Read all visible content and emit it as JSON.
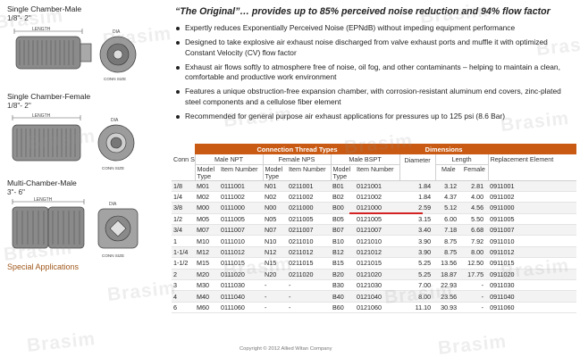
{
  "left": {
    "products": [
      {
        "title": "Single Chamber-Male",
        "size": "1/8\"- 2\"",
        "dim_length": "LENGTH",
        "dim_dia": "DIA",
        "dim_conn": "CONN SIZE"
      },
      {
        "title": "Single Chamber-Female",
        "size": "1/8\"- 2\"",
        "dim_length": "LENGTH",
        "dim_dia": "DIA",
        "dim_conn": "CONN SIZE"
      },
      {
        "title": "Multi-Chamber-Male",
        "size": "3\"- 6\"",
        "dim_length": "LENGTH",
        "dim_dia": "DIA",
        "dim_conn": "CONN SIZE"
      }
    ],
    "special_link": "Special Applications"
  },
  "headline": "“The Original”… provides up to 85% perceived noise reduction and 94% flow factor",
  "bullets": [
    "Expertly reduces Exponentially Perceived Noise (EPNdB) without impeding equipment performance",
    "Designed to take explosive air exhaust noise discharged from valve exhaust ports and muffle it with optimized Constant Velocity (CV) flow factor",
    "Exhaust air flows softly to atmosphere free of noise, oil fog, and other contaminants – helping to maintain a clean, comfortable and productive work environment",
    "Features a unique obstruction-free expansion chamber, with corrosion-resistant aluminum end covers, zinc-plated steel components and a cellulose fiber element",
    "Recommended for general purpose air exhaust applications for pressures up to 125 psi (8.6 Bar)"
  ],
  "table": {
    "band_connection": "Connection Thread Types",
    "band_dimensions": "Dimensions",
    "h_conn": "Conn Size",
    "h_male_npt": "Male NPT",
    "h_female_nps": "Female NPS",
    "h_male_bspt": "Male BSPT",
    "h_diameter": "Diameter",
    "h_length": "Length",
    "h_replacement": "Replacement Element",
    "h_model_type": "Model Type",
    "h_item_number": "Item Number",
    "h_male": "Male",
    "h_female": "Female",
    "rows": [
      [
        "1/8",
        "M01",
        "0111001",
        "N01",
        "0211001",
        "B01",
        "0121001",
        "1.84",
        "3.12",
        "2.81",
        "0911001"
      ],
      [
        "1/4",
        "M02",
        "0111002",
        "N02",
        "0211002",
        "B02",
        "0121002",
        "1.84",
        "4.37",
        "4.00",
        "0911002"
      ],
      [
        "3/8",
        "M00",
        "0111000",
        "N00",
        "0211000",
        "B00",
        "0121000",
        "2.59",
        "5.12",
        "4.56",
        "0911000"
      ],
      [
        "1/2",
        "M05",
        "0111005",
        "N05",
        "0211005",
        "B05",
        "0121005",
        "3.15",
        "6.00",
        "5.50",
        "0911005"
      ],
      [
        "3/4",
        "M07",
        "0111007",
        "N07",
        "0211007",
        "B07",
        "0121007",
        "3.40",
        "7.18",
        "6.68",
        "0911007"
      ],
      [
        "1",
        "M10",
        "0111010",
        "N10",
        "0211010",
        "B10",
        "0121010",
        "3.90",
        "8.75",
        "7.92",
        "0911010"
      ],
      [
        "1-1/4",
        "M12",
        "0111012",
        "N12",
        "0211012",
        "B12",
        "0121012",
        "3.90",
        "8.75",
        "8.00",
        "0911012"
      ],
      [
        "1-1/2",
        "M15",
        "0111015",
        "N15",
        "0211015",
        "B15",
        "0121015",
        "5.25",
        "13.56",
        "12.50",
        "0911015"
      ],
      [
        "2",
        "M20",
        "0111020",
        "N20",
        "0211020",
        "B20",
        "0121020",
        "5.25",
        "18.87",
        "17.75",
        "0911020"
      ],
      [
        "3",
        "M30",
        "0111030",
        "-",
        "-",
        "B30",
        "0121030",
        "7.00",
        "22.93",
        "-",
        "0911030"
      ],
      [
        "4",
        "M40",
        "0111040",
        "-",
        "-",
        "B40",
        "0121040",
        "8.00",
        "23.56",
        "-",
        "0911040"
      ],
      [
        "6",
        "M60",
        "0111060",
        "-",
        "-",
        "B60",
        "0121060",
        "11.10",
        "30.93",
        "-",
        "0911060"
      ]
    ]
  },
  "copyright": "Copyright © 2012 Allied Witan Company",
  "watermark": "Brasim",
  "colors": {
    "band": "#c85a13",
    "accent_link": "#a0581c",
    "highlight_underline": "#d32222"
  }
}
